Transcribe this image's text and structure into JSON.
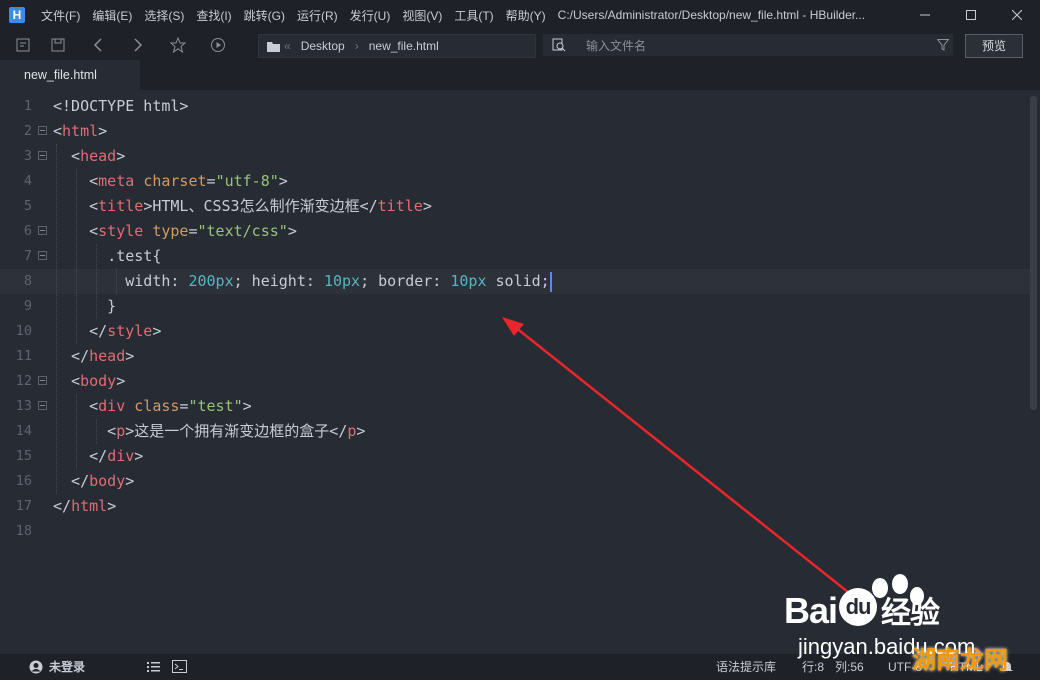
{
  "app": {
    "icon_letter": "H",
    "menu": [
      "文件(F)",
      "编辑(E)",
      "选择(S)",
      "查找(I)",
      "跳转(G)",
      "运行(R)",
      "发行(U)",
      "视图(V)",
      "工具(T)",
      "帮助(Y)"
    ],
    "window_title": "C:/Users/Administrator/Desktop/new_file.html - HBuilder..."
  },
  "toolbar": {
    "breadcrumb_root": "Desktop",
    "breadcrumb_file": "new_file.html",
    "search_placeholder": "输入文件名",
    "preview_label": "预览"
  },
  "tabs": [
    {
      "label": "new_file.html",
      "active": true
    }
  ],
  "editor": {
    "current_line": 8,
    "lines": [
      "<!DOCTYPE html>",
      "<html>",
      "  <head>",
      "    <meta charset=\"utf-8\">",
      "    <title>HTML、CSS3怎么制作渐变边框</title>",
      "    <style type=\"text/css\">",
      "      .test{",
      "        width: 200px; height: 10px; border: 10px solid;",
      "      }",
      "    </style>",
      "  </head>",
      "  <body>",
      "    <div class=\"test\">",
      "      <p>这是一个拥有渐变边框的盒子</p>",
      "    </div>",
      "  </body>",
      "</html>",
      ""
    ]
  },
  "statusbar": {
    "login": "未登录",
    "syntax_lib": "语法提示库",
    "line": "行:8",
    "col": "列:56",
    "encoding": "UTF-8",
    "language": "HTML"
  },
  "watermark": {
    "brand": "Bai",
    "brand2": "du",
    "cn": "经验",
    "url": "jingyan.baidu.com",
    "corner": "湖南龙网"
  },
  "colors": {
    "annotation_arrow": "#e8262b",
    "cursor": "#528bff",
    "tag": "#e06c75",
    "attr": "#d19a66",
    "string": "#98c379",
    "number": "#56b6c2"
  }
}
